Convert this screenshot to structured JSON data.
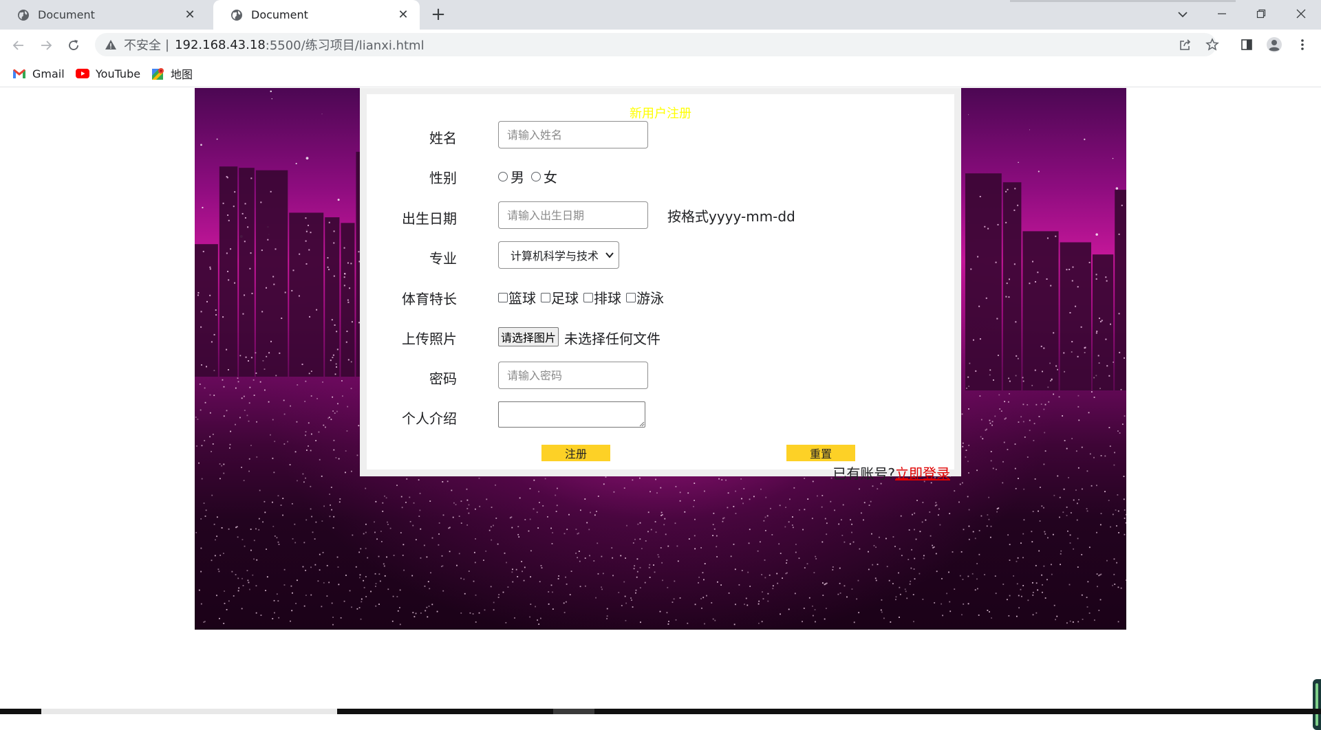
{
  "tabs": [
    {
      "title": "Document",
      "active": false
    },
    {
      "title": "Document",
      "active": true
    }
  ],
  "new_tab_symbol": "+",
  "address": {
    "security_text": "不安全",
    "separator": "|",
    "host": "192.168.43.18",
    "path": ":5500/练习项目/lianxi.html"
  },
  "bookmarks": [
    {
      "label": "Gmail",
      "icon": "gmail-icon"
    },
    {
      "label": "YouTube",
      "icon": "youtube-icon"
    },
    {
      "label": "地图",
      "icon": "maps-icon"
    }
  ],
  "form": {
    "title": "新用户注册",
    "title_color": "#ffff00",
    "name": {
      "label": "姓名",
      "placeholder": "请输入姓名"
    },
    "gender": {
      "label": "性别",
      "options": [
        "男",
        "女"
      ]
    },
    "birthday": {
      "label": "出生日期",
      "placeholder": "请输入出生日期",
      "hint": "按格式yyyy-mm-dd"
    },
    "major": {
      "label": "专业",
      "selected": "计算机科学与技术"
    },
    "sports": {
      "label": "体育特长",
      "options": [
        "篮球",
        "足球",
        "排球",
        "游泳"
      ]
    },
    "photo": {
      "label": "上传照片",
      "button": "请选择图片",
      "status": "未选择任何文件"
    },
    "password": {
      "label": "密码",
      "placeholder": "请输入密码"
    },
    "intro": {
      "label": "个人介绍",
      "value": ""
    },
    "submit_label": "注册",
    "reset_label": "重置",
    "button_color": "#fdd126",
    "login_prompt": "已有账号?",
    "login_link": "立即登录",
    "link_color": "#e00000"
  }
}
